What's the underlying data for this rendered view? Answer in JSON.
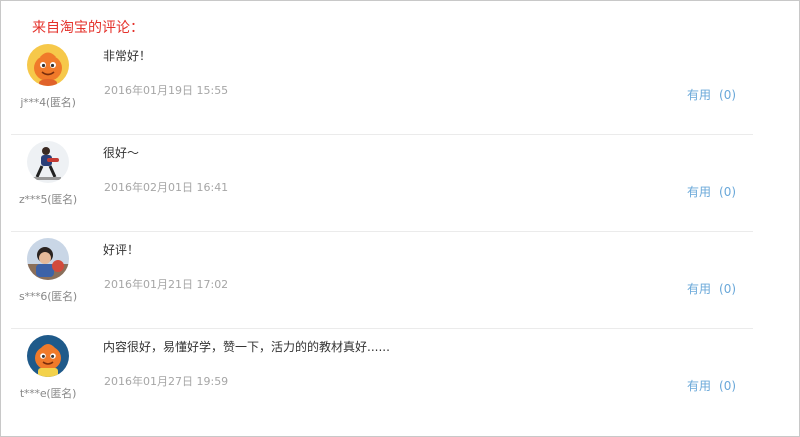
{
  "section": {
    "title": "来自淘宝的评论："
  },
  "reviews": [
    {
      "user": "j***4(匿名)",
      "content": "非常好！",
      "date": "2016年01月19日 15:55",
      "useful_label": "有用",
      "useful_count": "(0)",
      "avatar_icon": "orange-mascot-avatar"
    },
    {
      "user": "z***5(匿名)",
      "content": "很好～",
      "date": "2016年02月01日 16:41",
      "useful_label": "有用",
      "useful_count": "(0)",
      "avatar_icon": "person-photo-avatar"
    },
    {
      "user": "s***6(匿名)",
      "content": "好评！",
      "date": "2016年01月21日 17:02",
      "useful_label": "有用",
      "useful_count": "(0)",
      "avatar_icon": "child-photo-avatar"
    },
    {
      "user": "t***e(匿名)",
      "content": "内容很好，易懂好学，赞一下，活力的的教材真好......",
      "date": "2016年01月27日 19:59",
      "useful_label": "有用",
      "useful_count": "(0)",
      "avatar_icon": "orange-mascot-dark-avatar"
    }
  ],
  "colors": {
    "title": "#e4322b",
    "link": "#6aa8d9",
    "meta": "#a6a6a6",
    "mascot": "#f07a2a"
  }
}
